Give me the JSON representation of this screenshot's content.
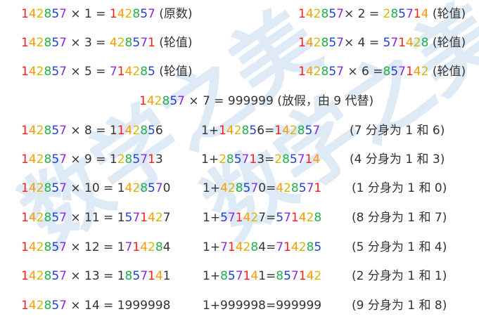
{
  "watermark": "数学之美",
  "colors": {
    "1": "#ff1a1a",
    "4": "#ff9900",
    "2": "#d4b800",
    "8": "#22b04a",
    "5": "#1f3fd8",
    "7": "#8a2be2",
    "other": "#333333"
  },
  "lines": [
    {
      "text": "142857 × 1 = 142857 (原数)",
      "segments": [
        {
          "t": "142857",
          "c": true
        },
        {
          "t": " × 1 = ",
          "c": false
        },
        {
          "t": "142857",
          "c": true
        },
        {
          "t": " (原数)",
          "c": false
        }
      ]
    },
    {
      "text": "142857× 2 = 285714 (轮值)",
      "segments": [
        {
          "t": "142857",
          "c": true
        },
        {
          "t": "× 2 = ",
          "c": false
        },
        {
          "t": "285714",
          "c": true
        },
        {
          "t": " (轮值)",
          "c": false
        }
      ]
    },
    {
      "text": "142857 × 3 = 428571 (轮值)",
      "segments": [
        {
          "t": "142857",
          "c": true
        },
        {
          "t": " × 3 = ",
          "c": false
        },
        {
          "t": "428571",
          "c": true
        },
        {
          "t": " (轮值)",
          "c": false
        }
      ]
    },
    {
      "text": "142857× 4 = 571428 (轮值)",
      "segments": [
        {
          "t": "142857",
          "c": true
        },
        {
          "t": "× 4 = ",
          "c": false
        },
        {
          "t": "571428",
          "c": true
        },
        {
          "t": " (轮值)",
          "c": false
        }
      ]
    },
    {
      "text": "142857 × 5 = 714285 (轮值)",
      "segments": [
        {
          "t": "142857",
          "c": true
        },
        {
          "t": " × 5 = ",
          "c": false
        },
        {
          "t": "714285",
          "c": true
        },
        {
          "t": " (轮值)",
          "c": false
        }
      ]
    },
    {
      "text": "142857 × 6 =857142 (轮值)",
      "segments": [
        {
          "t": "142857",
          "c": true
        },
        {
          "t": " × 6 =",
          "c": false
        },
        {
          "t": "857142",
          "c": true
        },
        {
          "t": " (轮值)",
          "c": false
        }
      ]
    },
    {
      "text": "142857 × 7 = 999999 (放假，由 9 代替)",
      "segments": [
        {
          "t": "142857",
          "c": true
        },
        {
          "t": " × 7 = 999999 (放假，由 9 代替)",
          "c": false
        }
      ]
    },
    {
      "text": "142857 × 8 = 1142856",
      "segments": [
        {
          "t": "142857",
          "c": true
        },
        {
          "t": " × 8 = 1",
          "c": false
        },
        {
          "t": "14285",
          "c": true
        },
        {
          "t": "6",
          "c": false
        }
      ]
    },
    {
      "text": "1+142856=142857",
      "segments": [
        {
          "t": "1+",
          "c": false
        },
        {
          "t": "14285",
          "c": true
        },
        {
          "t": "6=",
          "c": false
        },
        {
          "t": "142857",
          "c": true
        }
      ]
    },
    {
      "text": "(7 分身为 1 和 6)",
      "segments": [
        {
          "t": "(7 分身为 1 和 6)",
          "c": false
        }
      ]
    },
    {
      "text": "142857 × 9 = 1285713",
      "segments": [
        {
          "t": "142857",
          "c": true
        },
        {
          "t": " × 9 = 1",
          "c": false
        },
        {
          "t": "28571",
          "c": true
        },
        {
          "t": "3",
          "c": false
        }
      ]
    },
    {
      "text": "1+285713=285714",
      "segments": [
        {
          "t": "1+",
          "c": false
        },
        {
          "t": "28571",
          "c": true
        },
        {
          "t": "3=",
          "c": false
        },
        {
          "t": "285714",
          "c": true
        }
      ]
    },
    {
      "text": "(4 分身为 1 和 3)",
      "segments": [
        {
          "t": "(4 分身为 1 和 3)",
          "c": false
        }
      ]
    },
    {
      "text": "142857 × 10 = 1428570",
      "segments": [
        {
          "t": "142857",
          "c": true
        },
        {
          "t": " × 10 = 1",
          "c": false
        },
        {
          "t": "42857",
          "c": true
        },
        {
          "t": "0",
          "c": false
        }
      ]
    },
    {
      "text": "1+428570=428571",
      "segments": [
        {
          "t": "1+",
          "c": false
        },
        {
          "t": "42857",
          "c": true
        },
        {
          "t": "0=",
          "c": false
        },
        {
          "t": "428571",
          "c": true
        }
      ]
    },
    {
      "text": "(1 分身为 1 和 0)",
      "segments": [
        {
          "t": "(1 分身为 1 和 0)",
          "c": false
        }
      ]
    },
    {
      "text": "142857 × 11 = 1571427",
      "segments": [
        {
          "t": "142857",
          "c": true
        },
        {
          "t": " × 11 = 1",
          "c": false
        },
        {
          "t": "57142",
          "c": true
        },
        {
          "t": "7",
          "c": false
        }
      ]
    },
    {
      "text": "1+571427=571428",
      "segments": [
        {
          "t": "1+",
          "c": false
        },
        {
          "t": "57142",
          "c": true
        },
        {
          "t": "7=",
          "c": false
        },
        {
          "t": "571428",
          "c": true
        }
      ]
    },
    {
      "text": "(8 分身为 1 和 7)",
      "segments": [
        {
          "t": "(8 分身为 1 和 7)",
          "c": false
        }
      ]
    },
    {
      "text": "142857 × 12 = 1714284",
      "segments": [
        {
          "t": "142857",
          "c": true
        },
        {
          "t": " × 12 = 1",
          "c": false
        },
        {
          "t": "71428",
          "c": true
        },
        {
          "t": "4",
          "c": false
        }
      ]
    },
    {
      "text": "1+714284=714285",
      "segments": [
        {
          "t": "1+",
          "c": false
        },
        {
          "t": "71428",
          "c": true
        },
        {
          "t": "4=",
          "c": false
        },
        {
          "t": "714285",
          "c": true
        }
      ]
    },
    {
      "text": "(5 分身为 1 和 4)",
      "segments": [
        {
          "t": "(5 分身为 1 和 4)",
          "c": false
        }
      ]
    },
    {
      "text": "142857 × 13 = 1857141",
      "segments": [
        {
          "t": "142857",
          "c": true
        },
        {
          "t": " × 13 = 1",
          "c": false
        },
        {
          "t": "85714",
          "c": true
        },
        {
          "t": "1",
          "c": false
        }
      ]
    },
    {
      "text": "1+857141=857142",
      "segments": [
        {
          "t": "1+",
          "c": false
        },
        {
          "t": "85714",
          "c": true
        },
        {
          "t": "1=",
          "c": false
        },
        {
          "t": "857142",
          "c": true
        }
      ]
    },
    {
      "text": "(2 分身为 1 和 1)",
      "segments": [
        {
          "t": "(2 分身为 1 和 1)",
          "c": false
        }
      ]
    },
    {
      "text": "142857 × 14 = 1999998",
      "segments": [
        {
          "t": "142857",
          "c": true
        },
        {
          "t": " × 14 = 1999998",
          "c": false
        }
      ]
    },
    {
      "text": "1+999998=999999",
      "segments": [
        {
          "t": "1+999998=999999",
          "c": false
        }
      ]
    },
    {
      "text": "(9 分身为 1 和 8)",
      "segments": [
        {
          "t": "(9 分身为 1 和 8)",
          "c": false
        }
      ]
    }
  ]
}
